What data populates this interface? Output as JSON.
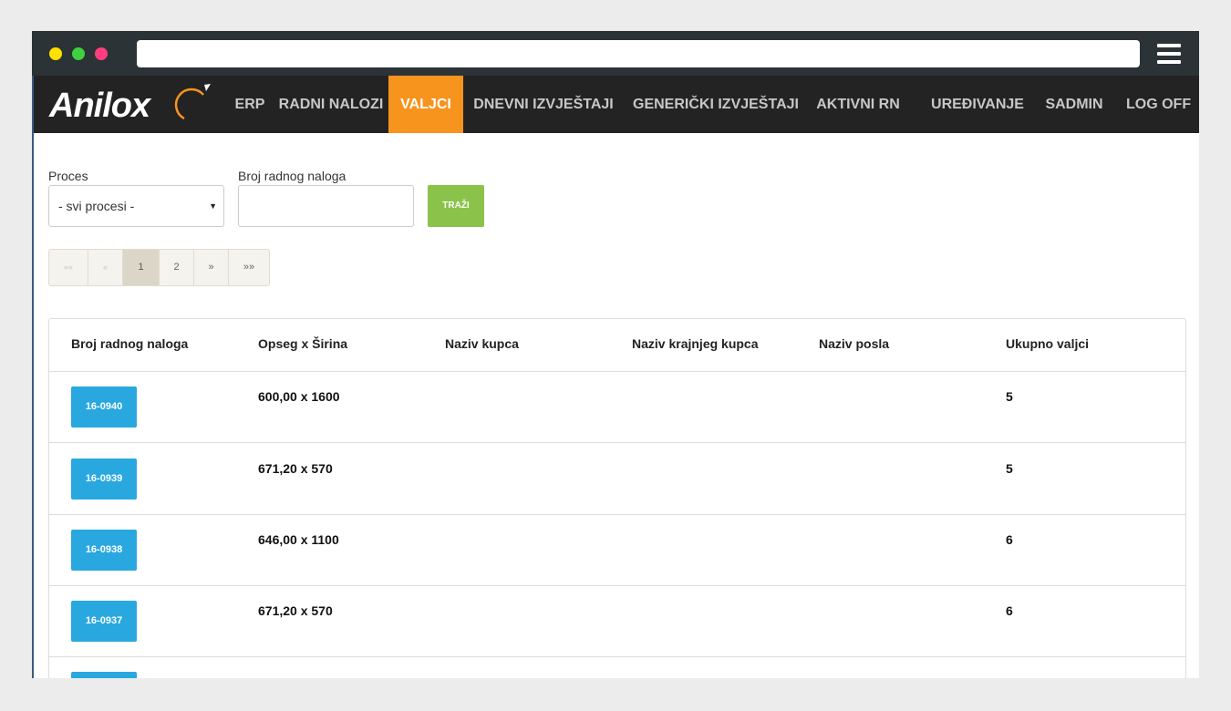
{
  "nav": {
    "items": [
      {
        "label": "ERP"
      },
      {
        "label": "RADNI NALOZI"
      },
      {
        "label": "VALJCI"
      },
      {
        "label": "DNEVNI IZVJEŠTAJI"
      },
      {
        "label": "GENERIČKI IZVJEŠTAJI"
      },
      {
        "label": "AKTIVNI RN"
      },
      {
        "label": "UREĐIVANJE"
      },
      {
        "label": "SADMIN"
      },
      {
        "label": "LOG OFF"
      }
    ],
    "active": "VALJCI",
    "active_color": "#f7941d"
  },
  "filters": {
    "proces_label": "Proces",
    "proces_value": "- svi procesi -",
    "rn_label": "Broj radnog naloga",
    "rn_value": "",
    "search_label": "TRAŽI"
  },
  "pagination": {
    "first": "««",
    "prev": "«",
    "pages": [
      "1",
      "2"
    ],
    "current": "1",
    "next": "»",
    "last": "»»"
  },
  "table": {
    "headers": [
      "Broj radnog naloga",
      "Opseg x Širina",
      "Naziv kupca",
      "Naziv krajnjeg kupca",
      "Naziv posla",
      "Ukupno valjci"
    ],
    "rows": [
      {
        "rn": "16-0940",
        "opseg": "600,00 x 1600",
        "kupac": "",
        "krajnji": "",
        "posao": "",
        "ukupno": "5"
      },
      {
        "rn": "16-0939",
        "opseg": "671,20 x 570",
        "kupac": "",
        "krajnji": "",
        "posao": "",
        "ukupno": "5"
      },
      {
        "rn": "16-0938",
        "opseg": "646,00 x 1100",
        "kupac": "",
        "krajnji": "",
        "posao": "",
        "ukupno": "6"
      },
      {
        "rn": "16-0937",
        "opseg": "671,20 x 570",
        "kupac": "",
        "krajnji": "",
        "posao": "",
        "ukupno": "6"
      }
    ]
  },
  "colors": {
    "button_blue": "#29a8e0",
    "button_green": "#8bc34a",
    "navbar": "#232323"
  }
}
